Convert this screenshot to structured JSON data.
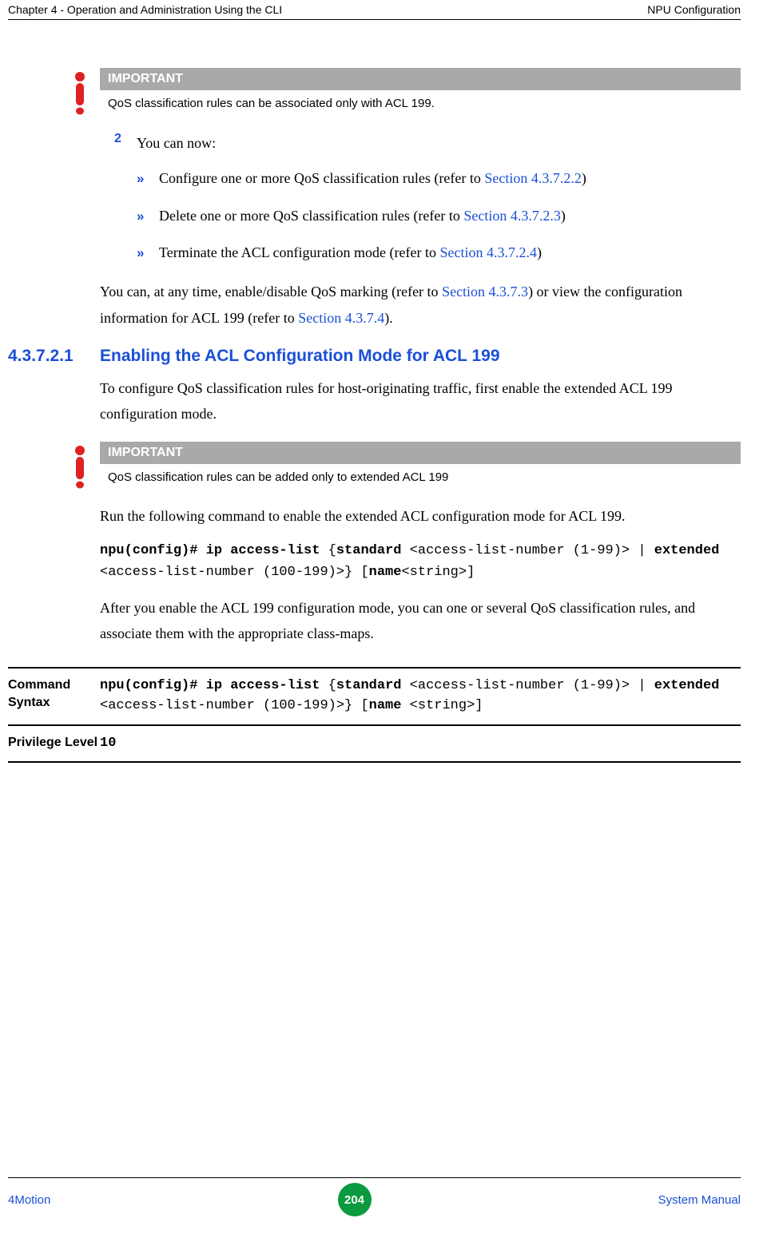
{
  "header": {
    "left": "Chapter 4 - Operation and Administration Using the CLI",
    "right": "NPU Configuration"
  },
  "important1": {
    "title": "IMPORTANT",
    "body": "QoS classification rules can be associated only with ACL 199."
  },
  "list": {
    "num2": "2",
    "num2_text": "You can now:",
    "arrow_glyph": "»",
    "a1_prefix": "Configure one or more QoS classification rules (refer to ",
    "a1_link": "Section 4.3.7.2.2",
    "a1_suffix": ")",
    "a2_prefix": "Delete one or more QoS classification rules (refer to ",
    "a2_link": "Section 4.3.7.2.3",
    "a2_suffix": ")",
    "a3_prefix": "Terminate the ACL configuration mode (refer to ",
    "a3_link": "Section 4.3.7.2.4",
    "a3_suffix": ")"
  },
  "para1": {
    "p1": "You can, at any time, enable/disable QoS marking (refer to ",
    "l1": "Section 4.3.7.3",
    "p2": ") or view the configuration information for ACL 199 (refer to ",
    "l2": "Section 4.3.7.4",
    "p3": ")."
  },
  "section": {
    "num": "4.3.7.2.1",
    "title": "Enabling the ACL Configuration Mode for ACL 199"
  },
  "para2": "To configure QoS classification rules for host-originating traffic, first enable the extended ACL 199 configuration mode.",
  "important2": {
    "title": "IMPORTANT",
    "body": "QoS classification rules can be added only to extended ACL 199"
  },
  "para3": "Run the following command to enable the extended ACL configuration mode for ACL 199.",
  "cmd_inline": {
    "t1": "npu(config)# ip access-list",
    "t2": " {",
    "t3": "standard",
    "t4": " <access-list-number (1-99)> | ",
    "t5": "extended",
    "t6": " <access-list-number (100-199)>} [",
    "t7": "name",
    "t8": "<string>]"
  },
  "para4": "After you enable the ACL 199 configuration mode, you can one or several QoS classification rules, and associate them with the appropriate class-maps.",
  "table": {
    "row1_label": "Command Syntax",
    "row1": {
      "t1": "npu(config)# ip access-list",
      "t2": " {",
      "t3": "standard",
      "t4": " <access-list-number (1-99)> | ",
      "t5": "extended",
      "t6": " <access-list-number (100-199)>} [",
      "t7": "name",
      "t8": " <string>]"
    },
    "row2_label": "Privilege Level",
    "row2_value": "10"
  },
  "footer": {
    "left": "4Motion",
    "page": "204",
    "right": "System Manual"
  }
}
